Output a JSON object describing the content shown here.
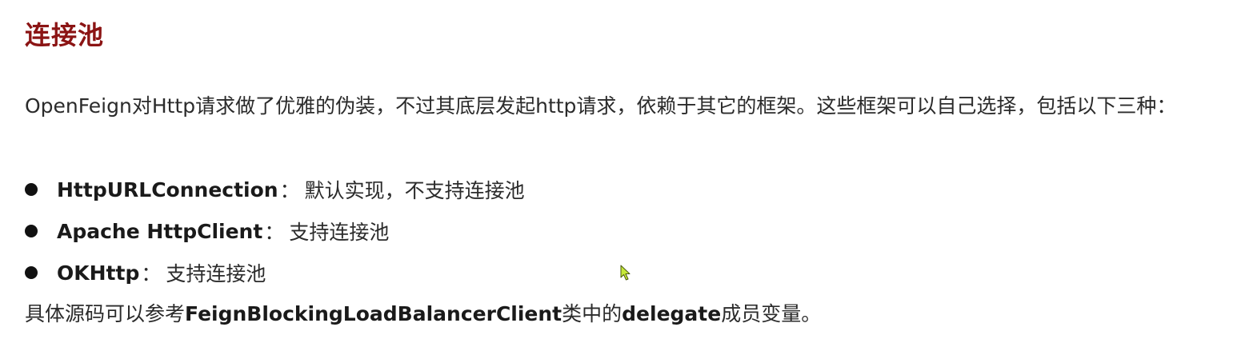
{
  "heading": "连接池",
  "intro": "OpenFeign对Http请求做了优雅的伪装，不过其底层发起http请求，依赖于其它的框架。这些框架可以自己选择，包括以下三种：",
  "bullets": [
    {
      "term": "HttpURLConnection",
      "separator": "：",
      "desc": "默认实现，不支持连接池"
    },
    {
      "term": "Apache HttpClient",
      "separator": " ：",
      "desc": "支持连接池"
    },
    {
      "term": "OKHttp",
      "separator": "：",
      "desc": "支持连接池"
    }
  ],
  "closing": {
    "part1": "具体源码可以参考",
    "class_name": "FeignBlockingLoadBalancerClient",
    "part2": "类中的",
    "field_name": "delegate",
    "part3": "成员变量。"
  },
  "cursor_icon": "mouse-pointer-icon",
  "colors": {
    "heading": "#8b1414",
    "text": "#2b2b2b",
    "cursor_fill": "#c6e83a"
  }
}
